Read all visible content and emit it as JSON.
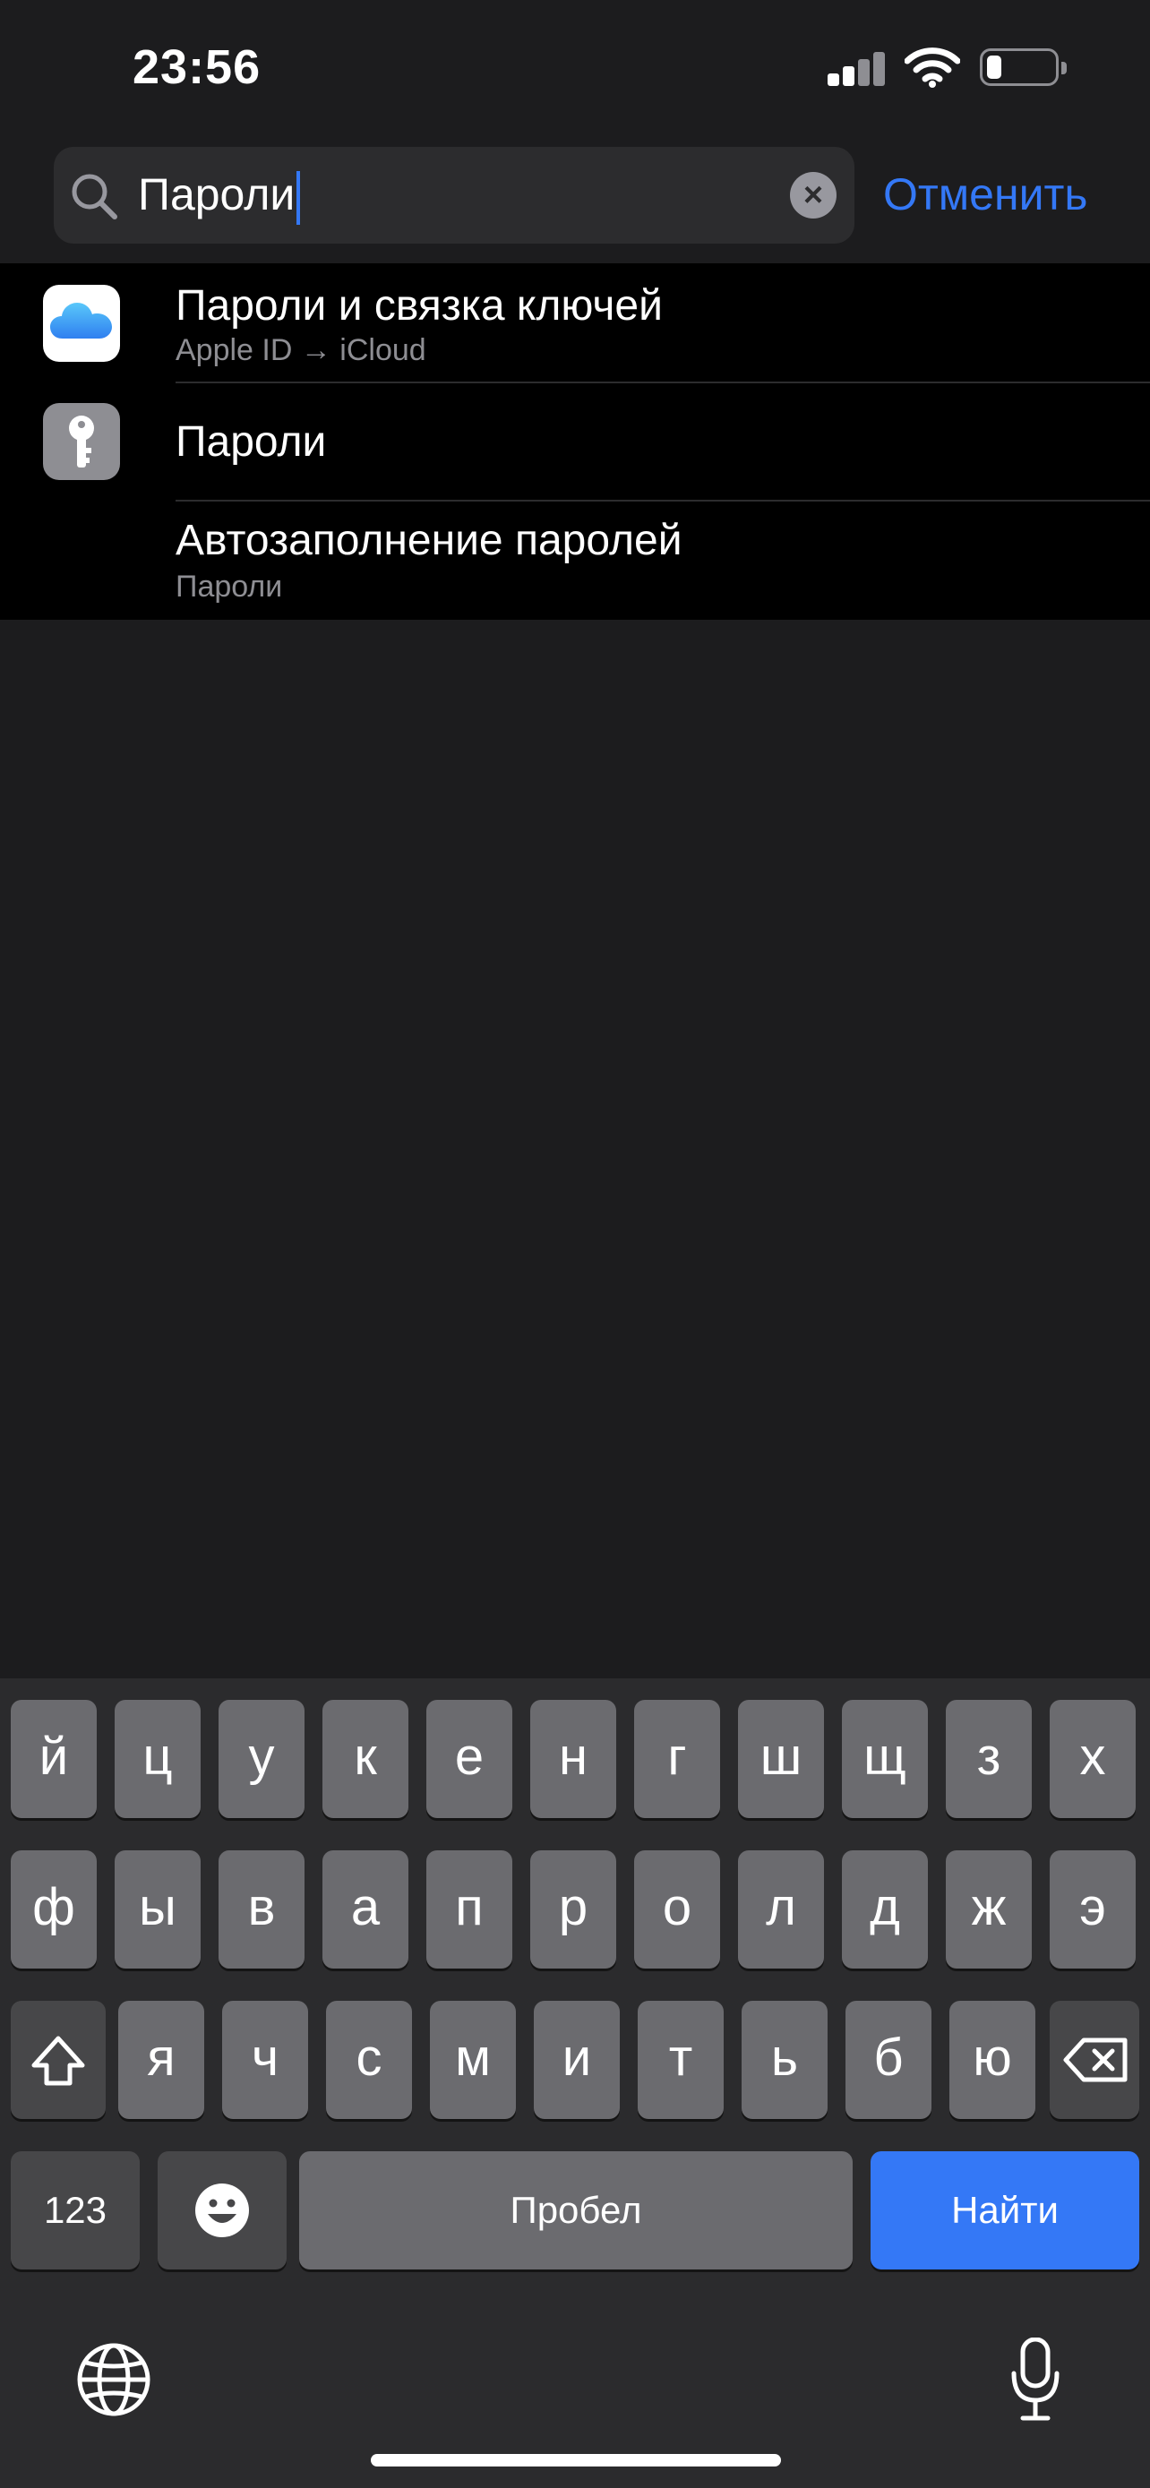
{
  "status_bar": {
    "time": "23:56"
  },
  "search": {
    "query": "Пароли",
    "cancel_label": "Отменить"
  },
  "results": [
    {
      "title": "Пароли и связка ключей",
      "subtitle": "Apple ID → iCloud",
      "icon": "icloud-icon"
    },
    {
      "title": "Пароли",
      "subtitle": "",
      "icon": "key-icon"
    },
    {
      "title": "Автозаполнение паролей",
      "subtitle": "Пароли",
      "icon": ""
    }
  ],
  "keyboard": {
    "row1": [
      "й",
      "ц",
      "у",
      "к",
      "е",
      "н",
      "г",
      "ш",
      "щ",
      "з",
      "х"
    ],
    "row2": [
      "ф",
      "ы",
      "в",
      "а",
      "п",
      "р",
      "о",
      "л",
      "д",
      "ж",
      "э"
    ],
    "row3": [
      "я",
      "ч",
      "с",
      "м",
      "и",
      "т",
      "ь",
      "б",
      "ю"
    ],
    "numbers_label": "123",
    "space_label": "Пробел",
    "go_label": "Найти"
  },
  "colors": {
    "accent": "#3478f6",
    "background": "#1c1c1e",
    "results_bg": "#000000"
  }
}
